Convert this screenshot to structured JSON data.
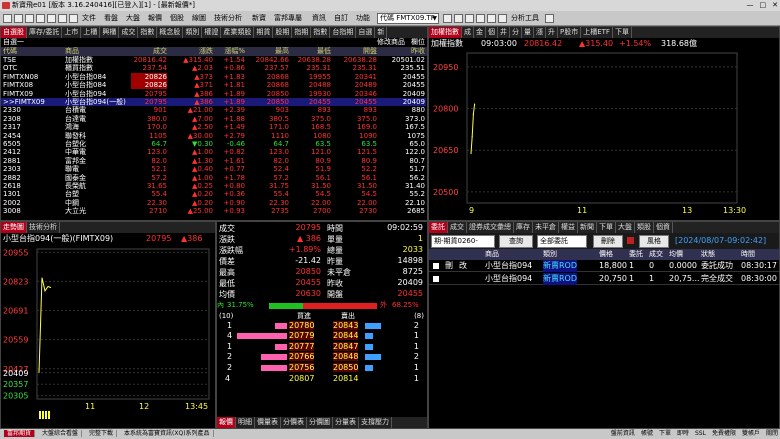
{
  "title_bar": "新寶飛e01 [版本 3.16.240416][已登入][1] - [最新報價*]",
  "toolbar": {
    "items": [
      "文件",
      "看盤",
      "大盤",
      "報價",
      "個股",
      "線圖",
      "技術分析",
      "新寶",
      "富邦專屬",
      "資訊",
      "自訂",
      "功能"
    ],
    "symbol_select": "代碼 FMTX09.TF",
    "analysis_label": "分析工具"
  },
  "watchlist": {
    "tabs": [
      "自選股",
      "庫存/委託",
      "上市",
      "上櫃",
      "興櫃",
      "成交",
      "指數",
      "概念股",
      "類別",
      "權證",
      "產業類股",
      "期貨",
      "股期",
      "指期",
      "指數",
      "台指期",
      "自選",
      "新"
    ],
    "group": "自選一",
    "edit_label": "修改商品",
    "settings_label": "欄位",
    "columns": [
      "代碼",
      "商品",
      "成交",
      "漲跌",
      "漲幅%",
      "最高",
      "最低",
      "開盤",
      "昨收"
    ],
    "rows": [
      {
        "code": "TSE",
        "name": "加權指數",
        "last": "20816.42",
        "chg": "▲315.40",
        "pct": "+1.54",
        "high": "20842.66",
        "low": "20638.28",
        "open": "20638.28",
        "prev": "20501.02",
        "dir": "up"
      },
      {
        "code": "OTC",
        "name": "櫃買指數",
        "last": "237.54",
        "chg": "▲2.03",
        "pct": "+0.86",
        "high": "237.57",
        "low": "235.31",
        "open": "235.31",
        "prev": "235.51",
        "dir": "up"
      },
      {
        "code": "FIMTXN08",
        "name": "小型台指084",
        "last": "20826",
        "chg": "▲373",
        "pct": "+1.83",
        "high": "20868",
        "low": "19955",
        "open": "20341",
        "prev": "20455",
        "dir": "up"
      },
      {
        "code": "FIMTX08",
        "name": "小型台指084",
        "last": "20826",
        "chg": "▲371",
        "pct": "+1.81",
        "high": "20868",
        "low": "20488",
        "open": "20489",
        "prev": "20455",
        "dir": "up"
      },
      {
        "code": "FIMTX09",
        "name": "小型台指094",
        "last": "20795",
        "chg": "▲386",
        "pct": "+1.89",
        "high": "20850",
        "low": "19930",
        "open": "20346",
        "prev": "20409",
        "dir": "up"
      },
      {
        "code": ">>FIMTX09",
        "name": "小型台指094(一般)",
        "last": "20795",
        "chg": "▲386",
        "pct": "+1.89",
        "high": "20850",
        "low": "20455",
        "open": "20455",
        "prev": "20409",
        "dir": "up"
      },
      {
        "code": "2330",
        "name": "台積電",
        "last": "901",
        "chg": "▲21.00",
        "pct": "+2.39",
        "high": "903",
        "low": "893",
        "open": "893",
        "prev": "880",
        "dir": "up"
      },
      {
        "code": "2308",
        "name": "台達電",
        "last": "380.0",
        "chg": "▲7.00",
        "pct": "+1.88",
        "high": "380.5",
        "low": "375.0",
        "open": "375.0",
        "prev": "373.0",
        "dir": "up"
      },
      {
        "code": "2317",
        "name": "鴻海",
        "last": "170.0",
        "chg": "▲2.50",
        "pct": "+1.49",
        "high": "171.0",
        "low": "168.5",
        "open": "169.0",
        "prev": "167.5",
        "dir": "up"
      },
      {
        "code": "2454",
        "name": "聯發科",
        "last": "1105",
        "chg": "▲30.00",
        "pct": "+2.79",
        "high": "1110",
        "low": "1080",
        "open": "1090",
        "prev": "1075",
        "dir": "up"
      },
      {
        "code": "6505",
        "name": "台塑化",
        "last": "64.7",
        "chg": "▼0.30",
        "pct": "-0.46",
        "high": "64.7",
        "low": "63.5",
        "open": "63.5",
        "prev": "65.0",
        "dir": "down"
      },
      {
        "code": "2412",
        "name": "中華電",
        "last": "123.0",
        "chg": "▲1.00",
        "pct": "+0.82",
        "high": "123.0",
        "low": "121.0",
        "open": "121.5",
        "prev": "122.0",
        "dir": "up"
      },
      {
        "code": "2881",
        "name": "富邦金",
        "last": "82.0",
        "chg": "▲1.30",
        "pct": "+1.61",
        "high": "82.0",
        "low": "80.9",
        "open": "80.9",
        "prev": "80.7",
        "dir": "up"
      },
      {
        "code": "2303",
        "name": "聯電",
        "last": "52.1",
        "chg": "▲0.40",
        "pct": "+0.77",
        "high": "52.4",
        "low": "51.9",
        "open": "52.2",
        "prev": "51.7",
        "dir": "up"
      },
      {
        "code": "2882",
        "name": "國泰金",
        "last": "57.2",
        "chg": "▲1.00",
        "pct": "+1.78",
        "high": "57.2",
        "low": "56.1",
        "open": "56.1",
        "prev": "56.2",
        "dir": "up"
      },
      {
        "code": "2618",
        "name": "長榮航",
        "last": "31.65",
        "chg": "▲0.25",
        "pct": "+0.80",
        "high": "31.75",
        "low": "31.50",
        "open": "31.50",
        "prev": "31.40",
        "dir": "up"
      },
      {
        "code": "1301",
        "name": "台塑",
        "last": "55.4",
        "chg": "▲0.20",
        "pct": "+0.36",
        "high": "55.4",
        "low": "54.5",
        "open": "54.5",
        "prev": "55.2",
        "dir": "up"
      },
      {
        "code": "2002",
        "name": "中鋼",
        "last": "22.30",
        "chg": "▲0.20",
        "pct": "+0.90",
        "high": "22.30",
        "low": "22.00",
        "open": "22.00",
        "prev": "22.10",
        "dir": "up"
      },
      {
        "code": "3008",
        "name": "大立光",
        "last": "2710",
        "chg": "▲25.00",
        "pct": "+0.93",
        "high": "2735",
        "low": "2700",
        "open": "2730",
        "prev": "2685",
        "dir": "up"
      }
    ]
  },
  "index_chart": {
    "tabs": [
      "加權指數",
      "成",
      "金",
      "個",
      "井",
      "分",
      "量",
      "漲",
      "升",
      "P股市",
      "上櫃ETF",
      "下單"
    ],
    "name": "加權指數",
    "time": "09:03:00",
    "value": "20816.42",
    "chg": "▲315.40",
    "pct": "+1.54%",
    "volume": "318.68億",
    "y_ticks": [
      "20950",
      "20800",
      "20650",
      "20500"
    ],
    "x_ticks": [
      "9",
      "11",
      "13",
      "13:30"
    ],
    "chart_data": {
      "type": "line",
      "x": [
        "09:00",
        "09:01",
        "09:02",
        "09:03"
      ],
      "values": [
        20638,
        20700,
        20780,
        20816
      ],
      "ylim": [
        20460,
        21000
      ]
    }
  },
  "futures_chart": {
    "title": "小型台指094(一般)(FIMTX09)",
    "price": "20795",
    "chg": "▲386",
    "y_ticks": [
      "20955",
      "20823",
      "20691",
      "20559",
      "20427",
      "20409",
      "20357",
      "20305"
    ],
    "x_ticks": [
      "11",
      "12",
      "13:45"
    ],
    "chart_data": {
      "type": "line",
      "x": [
        "08:45",
        "08:50",
        "08:55",
        "09:00",
        "09:02"
      ],
      "values": [
        20409,
        20840,
        20780,
        20800,
        20795
      ],
      "ylim": [
        20290,
        20970
      ]
    }
  },
  "quote_panel": {
    "fields": [
      {
        "l": "成交",
        "v": "20795",
        "c": "r",
        "l2": "時間",
        "v2": "09:02:59",
        "c2": "w"
      },
      {
        "l": "漲跌",
        "v": "▲ 386",
        "c": "r",
        "l2": "單量",
        "v2": "1",
        "c2": "y"
      },
      {
        "l": "漲跌幅",
        "v": "+1.89%",
        "c": "r",
        "l2": "總量",
        "v2": "2033",
        "c2": "y"
      },
      {
        "l": "價差",
        "v": "-21.42",
        "c": "w",
        "l2": "昨量",
        "v2": "14898",
        "c2": "w"
      },
      {
        "l": "最高",
        "v": "20850",
        "c": "r",
        "l2": "未平倉",
        "v2": "8725",
        "c2": "w"
      },
      {
        "l": "最低",
        "v": "20455",
        "c": "r",
        "l2": "昨收",
        "v2": "20409",
        "c2": "w"
      },
      {
        "l": "均價",
        "v": "20630",
        "c": "r",
        "l2": "開盤",
        "v2": "20455",
        "c2": "r"
      }
    ],
    "inner_label": "內",
    "inner_pct": "31.75%",
    "inner_ratio": 0.3175,
    "outer_label": "外",
    "outer_pct": "68.25%",
    "bid_count": "(10)",
    "ask_count": "(8)",
    "bid_header": "買進",
    "ask_header": "賣出",
    "depth": [
      {
        "bq": "1",
        "bp": "20780",
        "ap": "20843",
        "aq": "2",
        "bw": 0.06
      },
      {
        "bq": "4",
        "bp": "20779",
        "ap": "20844",
        "aq": "1",
        "bw": 0.25
      },
      {
        "bq": "1",
        "bp": "20777",
        "ap": "20847",
        "aq": "1",
        "bw": 0.06
      },
      {
        "bq": "2",
        "bp": "20766",
        "ap": "20848",
        "aq": "2",
        "bw": 0.13
      },
      {
        "bq": "2",
        "bp": "20756",
        "ap": "20850",
        "aq": "1",
        "bw": 0.13
      }
    ],
    "bid_total": "4",
    "bid_total2": "20807",
    "ask_total": "20814",
    "ask_total2": "1",
    "bottom_tabs": [
      "報價",
      "明細",
      "價量表",
      "分價表",
      "分價圖",
      "分量表",
      "支撐壓力"
    ]
  },
  "technical": {
    "tabs": [
      "走勢圖",
      "技術分析"
    ]
  },
  "orders": {
    "tabs": [
      "委託",
      "成交",
      "證券成交彙總",
      "庫存",
      "未平倉",
      "權益",
      "新聞",
      "下單",
      "大盤",
      "類股",
      "個資"
    ],
    "account": "期-期貨0260-",
    "query_label": "查詢",
    "filter": "全部委託",
    "delete_label": "刪除",
    "risk_label": "風格",
    "timestamp": "[2024/08/07-09:02:42]",
    "columns": [
      "",
      "",
      "商品",
      "類別",
      "價格",
      "委託",
      "成交",
      "均價",
      "狀態",
      "時間"
    ],
    "rows": [
      {
        "del": "刪",
        "mod": "改",
        "product": "小型台指094",
        "type": "新賣ROD",
        "price": "18,800",
        "qty": "1",
        "filled": "0",
        "avg": "0.0000",
        "status": "委託成功",
        "time": "08:30:17"
      },
      {
        "del": "",
        "mod": "",
        "product": "小型台指094",
        "type": "新賣ROD",
        "price": "20,750",
        "qty": "1",
        "filled": "1",
        "avg": "20,75...",
        "status": "完全成交",
        "time": "08:30:00"
      }
    ]
  },
  "status_bar": {
    "items": [
      "富邦期貨",
      "大盤綜合看盤",
      "完整下載",
      "本系統為富寶資訊(XQ)系列產品"
    ],
    "right": [
      "盤前資訊",
      "帳號",
      "下單",
      "即時",
      "SSL",
      "免費權限",
      "雙帳戶",
      "關閉"
    ]
  },
  "colors": {
    "up": "#ff3030",
    "down": "#30e030",
    "accent": "#b0001a"
  }
}
